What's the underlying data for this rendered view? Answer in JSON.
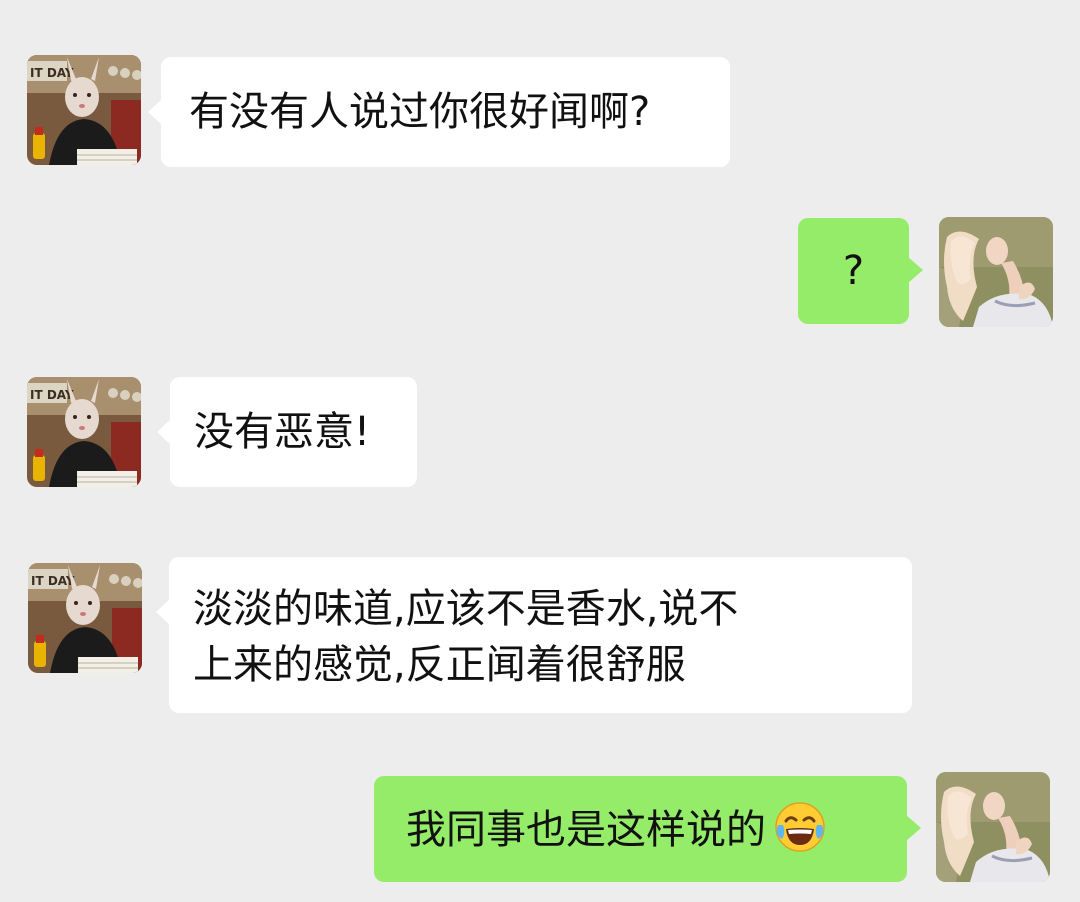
{
  "messages": [
    {
      "side": "in",
      "text": "有没有人说过你很好闻啊?"
    },
    {
      "side": "out",
      "text": "?"
    },
    {
      "side": "in",
      "text": "没有恶意!"
    },
    {
      "side": "in",
      "text": "淡淡的味道,应该不是香水,说不\n上来的感觉,反正闻着很舒服"
    },
    {
      "side": "out",
      "text": "我同事也是这样说的",
      "emoji": "face-with-tears-of-joy-icon"
    }
  ],
  "colors": {
    "background": "#ededed",
    "incoming_bubble": "#ffffff",
    "outgoing_bubble": "#95ec69"
  }
}
